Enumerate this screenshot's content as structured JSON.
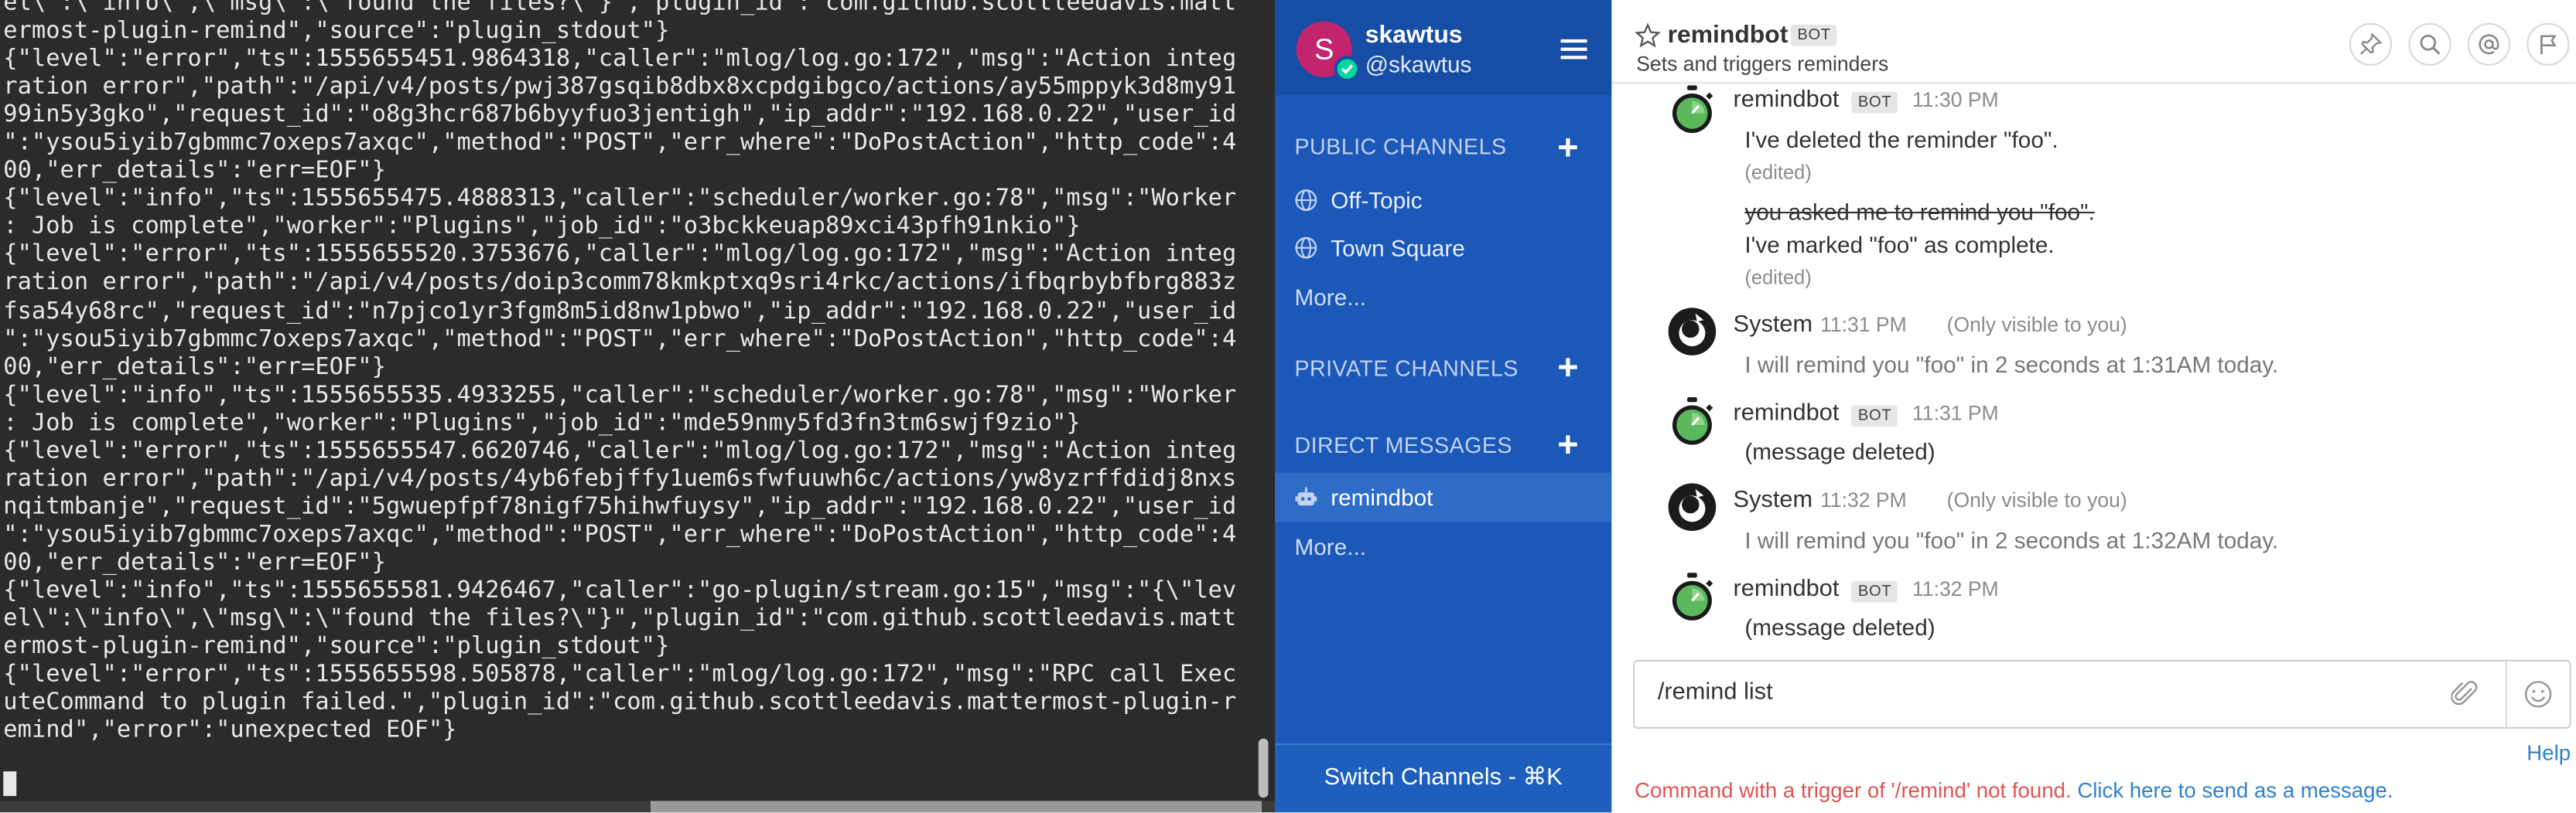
{
  "terminal": {
    "lines": [
      "el\\\":\\\"info\\\",\\\"msg\\\":\\\"found the files?\\\"}\",\"plugin_id\":\"com.github.scottleedavis.matt",
      "ermost-plugin-remind\",\"source\":\"plugin_stdout\"}",
      "{\"level\":\"error\",\"ts\":1555655451.9864318,\"caller\":\"mlog/log.go:172\",\"msg\":\"Action integ",
      "ration error\",\"path\":\"/api/v4/posts/pwj387gsqib8dbx8xcpdgibgco/actions/ay55mppyk3d8my91",
      "99in5y3gko\",\"request_id\":\"o8g3hcr687b6byyfuo3jentigh\",\"ip_addr\":\"192.168.0.22\",\"user_id",
      "\":\"ysou5iyib7gbmmc7oxeps7axqc\",\"method\":\"POST\",\"err_where\":\"DoPostAction\",\"http_code\":4",
      "00,\"err_details\":\"err=EOF\"}",
      "{\"level\":\"info\",\"ts\":1555655475.4888313,\"caller\":\"scheduler/worker.go:78\",\"msg\":\"Worker",
      ": Job is complete\",\"worker\":\"Plugins\",\"job_id\":\"o3bckkeuap89xci43pfh91nkio\"}",
      "{\"level\":\"error\",\"ts\":1555655520.3753676,\"caller\":\"mlog/log.go:172\",\"msg\":\"Action integ",
      "ration error\",\"path\":\"/api/v4/posts/doip3comm78kmkptxq9sri4rkc/actions/ifbqrbybfbrg883z",
      "fsa54y68rc\",\"request_id\":\"n7pjco1yr3fgm8m5id8nw1pbwo\",\"ip_addr\":\"192.168.0.22\",\"user_id",
      "\":\"ysou5iyib7gbmmc7oxeps7axqc\",\"method\":\"POST\",\"err_where\":\"DoPostAction\",\"http_code\":4",
      "00,\"err_details\":\"err=EOF\"}",
      "{\"level\":\"info\",\"ts\":1555655535.4933255,\"caller\":\"scheduler/worker.go:78\",\"msg\":\"Worker",
      ": Job is complete\",\"worker\":\"Plugins\",\"job_id\":\"mde59nmy5fd3fn3tm6swjf9zio\"}",
      "{\"level\":\"error\",\"ts\":1555655547.6620746,\"caller\":\"mlog/log.go:172\",\"msg\":\"Action integ",
      "ration error\",\"path\":\"/api/v4/posts/4yb6febjffy1uem6sfwfuuwh6c/actions/yw8yzrffdidj8nxs",
      "nqitmbanje\",\"request_id\":\"5gwuepfpf78nigf75hihwfuysy\",\"ip_addr\":\"192.168.0.22\",\"user_id",
      "\":\"ysou5iyib7gbmmc7oxeps7axqc\",\"method\":\"POST\",\"err_where\":\"DoPostAction\",\"http_code\":4",
      "00,\"err_details\":\"err=EOF\"}",
      "{\"level\":\"info\",\"ts\":1555655581.9426467,\"caller\":\"go-plugin/stream.go:15\",\"msg\":\"{\\\"lev",
      "el\\\":\\\"info\\\",\\\"msg\\\":\\\"found the files?\\\"}\",\"plugin_id\":\"com.github.scottleedavis.matt",
      "ermost-plugin-remind\",\"source\":\"plugin_stdout\"}",
      "{\"level\":\"error\",\"ts\":1555655598.505878,\"caller\":\"mlog/log.go:172\",\"msg\":\"RPC call Exec",
      "uteCommand to plugin failed.\",\"plugin_id\":\"com.github.scottleedavis.mattermost-plugin-r",
      "emind\",\"error\":\"unexpected EOF\"}"
    ]
  },
  "sidebar": {
    "avatar_letter": "S",
    "username": "skawtus",
    "handle": "@skawtus",
    "public_header": "PUBLIC CHANNELS",
    "private_header": "PRIVATE CHANNELS",
    "direct_header": "DIRECT MESSAGES",
    "plus": "+",
    "channels": [
      {
        "label": "Off-Topic",
        "icon": "globe-icon"
      },
      {
        "label": "Town Square",
        "icon": "globe-icon"
      }
    ],
    "public_more": "More...",
    "dm_item": {
      "label": "remindbot",
      "icon": "bot-icon"
    },
    "dm_more": "More...",
    "switch_channels": "Switch Channels - ⌘K",
    "colors": {
      "bg": "#1b58b8",
      "header": "#174ea5",
      "avatar": "#c2246d",
      "online": "#06d6a0"
    }
  },
  "channel": {
    "name": "remindbot",
    "bot_badge": "BOT",
    "purpose": "Sets and triggers reminders"
  },
  "posts": {
    "p1": {
      "author": "remindbot",
      "badge": "BOT",
      "time": "11:30 PM",
      "text": "I've deleted the reminder \"foo\".",
      "edited": "(edited)",
      "struck": "you asked me to remind you \"foo\".",
      "text2": "I've marked \"foo\" as complete.",
      "edited2": "(edited)"
    },
    "p2": {
      "author": "System",
      "time": "11:31 PM",
      "note": "(Only visible to you)",
      "text": "I will remind you \"foo\" in 2 seconds at 1:31AM today."
    },
    "p3": {
      "author": "remindbot",
      "badge": "BOT",
      "time": "11:31 PM",
      "text": "(message deleted)"
    },
    "p4": {
      "author": "System",
      "time": "11:32 PM",
      "note": "(Only visible to you)",
      "text": "I will remind you \"foo\" in 2 seconds at 1:32AM today."
    },
    "p5": {
      "author": "remindbot",
      "badge": "BOT",
      "time": "11:32 PM",
      "text": "(message deleted)"
    }
  },
  "composer": {
    "value": "/remind list",
    "help": "Help",
    "error": "Command with a trigger of '/remind' not found.",
    "error_link": "Click here to send as a message."
  }
}
